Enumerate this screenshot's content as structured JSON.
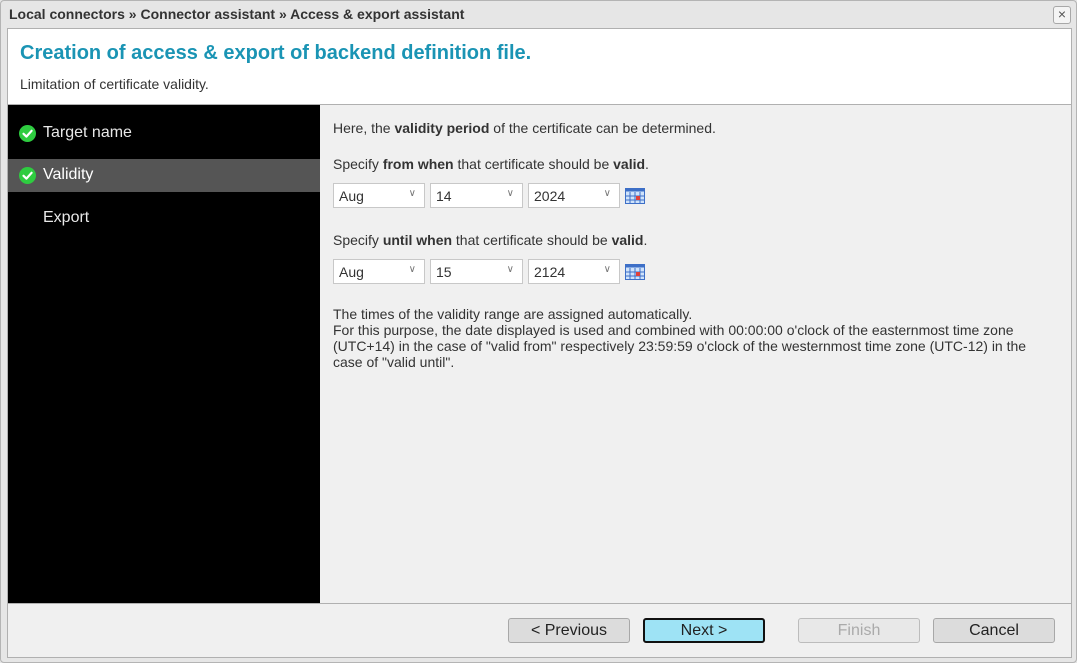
{
  "window": {
    "breadcrumb": "Local connectors » Connector assistant » Access & export assistant",
    "close_icon": "×"
  },
  "header": {
    "title": "Creation of access & export of backend definition file.",
    "subtitle": "Limitation of certificate validity."
  },
  "sidebar": {
    "steps": [
      {
        "label": "Target name",
        "completed": true,
        "active": false
      },
      {
        "label": "Validity",
        "completed": true,
        "active": true
      },
      {
        "label": "Export",
        "completed": false,
        "active": false
      }
    ]
  },
  "content": {
    "intro": {
      "pre": "Here, the ",
      "bold": "validity period",
      "post": " of the certificate can be determined."
    },
    "from": {
      "label_pre": "Specify ",
      "label_bold": "from when",
      "label_mid": " that certificate should be ",
      "label_bold2": "valid",
      "label_post": ".",
      "month": "Aug",
      "day": "14",
      "year": "2024"
    },
    "until": {
      "label_pre": "Specify ",
      "label_bold": "until when",
      "label_mid": " that certificate should be ",
      "label_bold2": "valid",
      "label_post": ".",
      "month": "Aug",
      "day": "15",
      "year": "2124"
    },
    "info_line1": "The times of the validity range are assigned automatically.",
    "info_line2": "For this purpose, the date displayed is used and combined with 00:00:00 o'clock of the easternmost time zone (UTC+14) in the case of \"valid from\" respectively 23:59:59 o'clock of the westernmost time zone (UTC-12) in the case of \"valid until\"."
  },
  "footer": {
    "previous": "< Previous",
    "next": "Next >",
    "finish": "Finish",
    "cancel": "Cancel"
  },
  "colors": {
    "title": "#1a94b4",
    "sidebar_bg": "#000000",
    "active_step": "#555555",
    "check": "#2ecc40",
    "primary_button": "#9ee3f5"
  }
}
